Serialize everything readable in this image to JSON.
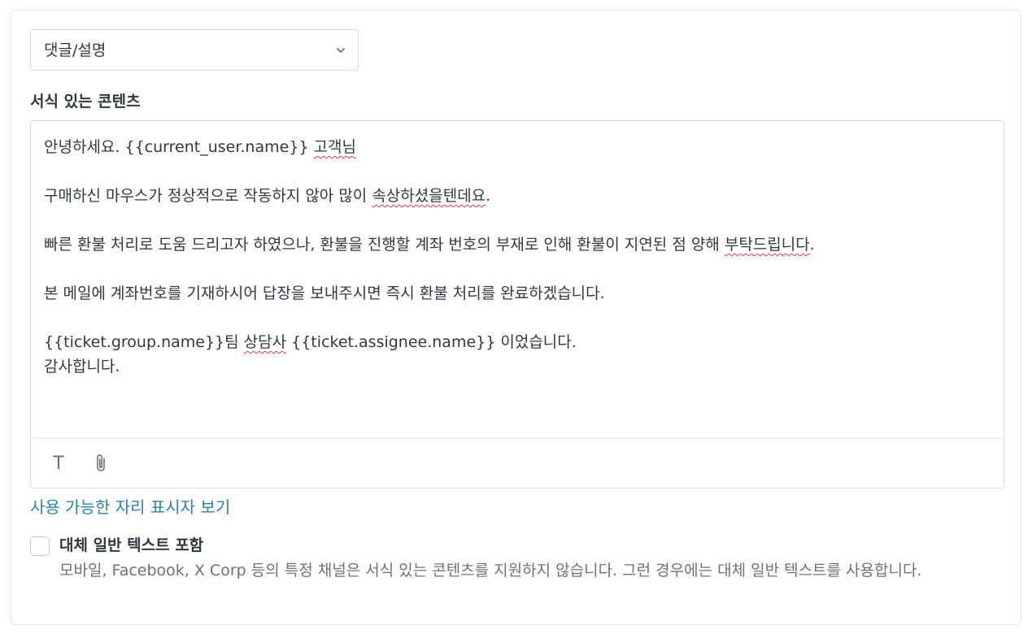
{
  "select": {
    "value": "댓글/설명",
    "icon": "chevron-down-icon"
  },
  "editor": {
    "label": "서식 있는 콘텐츠",
    "line1": {
      "a": "안녕하세요. {{current_user.name}} ",
      "b": "고객님"
    },
    "line2": {
      "a": "구매하신 마우스가 정상적으로 작동하지 않아 많이 ",
      "b": "속상하셨을텐데요",
      "c": "."
    },
    "line3": {
      "a": "빠른 환불 처리로 도움 드리고자 하였으나, 환불을 진행할 계좌 번호의 부재로 인해 환불이 지연된 점 양해 ",
      "b": "부탁드립니다",
      "c": "."
    },
    "line4": "본 메일에 계좌번호를 기재하시어 답장을 보내주시면 즉시 환불 처리를 완료하겠습니다.",
    "line5": {
      "a": "{{ticket.group.name}}팀 ",
      "b": "상담사",
      "c": " {{ticket.assignee.name}} 이었습니다."
    },
    "line6": "감사합니다.",
    "toolbar": {
      "text_format_glyph": "T",
      "text_format_icon": "text-format-icon",
      "attach_icon": "paperclip-icon"
    }
  },
  "placeholders_link": "사용 가능한 자리 표시자 보기",
  "plain_text": {
    "label": "대체 일반 텍스트 포함",
    "hint": "모바일, Facebook, X Corp 등의 특정 채널은 서식 있는 콘텐츠를 지원하지 않습니다. 그런 경우에는 대체 일반 텍스트를 사용합니다.",
    "checked": false
  },
  "colors": {
    "link": "#2c84a3",
    "spellcheck": "#d93f4c",
    "text": "#2f3941",
    "muted": "#68737d",
    "border": "#d8dcde"
  }
}
